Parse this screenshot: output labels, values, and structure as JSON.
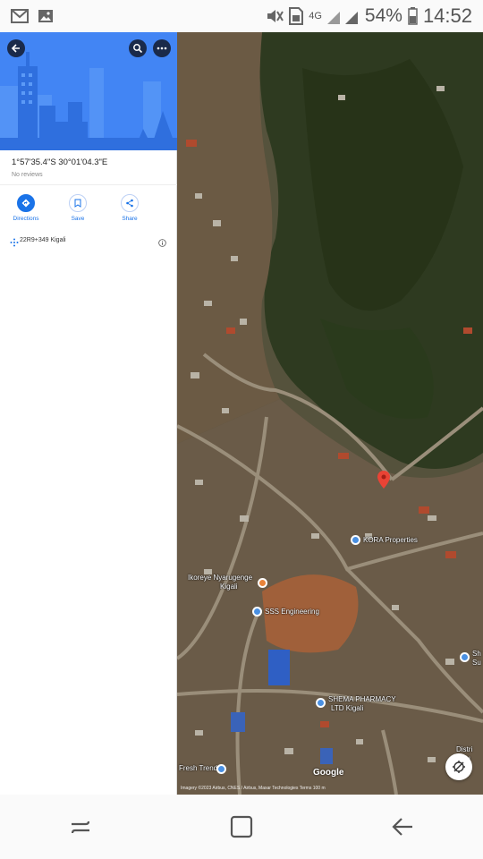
{
  "status_bar": {
    "battery": "54%",
    "time": "14:52",
    "network": "4G",
    "icons": [
      "gmail-icon",
      "gallery-icon",
      "mute-icon",
      "sim-icon",
      "signal-icon",
      "battery-icon"
    ]
  },
  "place": {
    "coordinates": "1°57'35.4\"S 30°01'04.3\"E",
    "reviews": "No reviews",
    "plus_code": "22R9+349 Kigali"
  },
  "actions": [
    {
      "label": "Directions",
      "icon": "directions-icon"
    },
    {
      "label": "Save",
      "icon": "bookmark-icon"
    },
    {
      "label": "Share",
      "icon": "share-icon"
    }
  ],
  "map": {
    "labels": {
      "kora": "KORA Properties",
      "nyarugenge": "Ikoreye Nyarugenge",
      "kigali": "Kigali",
      "sss": "SSS Engineering",
      "pharmacy": "SHEMA PHARMACY",
      "ltd": "LTD Kigali",
      "fresh": "Fresh Trends",
      "sh": "Sh",
      "su": "Su",
      "dist": "Distri",
      "su2": "Su",
      "google": "Google",
      "attribution": "Imagery ©2023 Airbus, CNES / Airbus, Maxar Technologies    Terms    100 m"
    }
  },
  "colors": {
    "accent": "#1a73e8",
    "hero": "#4285f4",
    "pin": "#ea4335"
  }
}
